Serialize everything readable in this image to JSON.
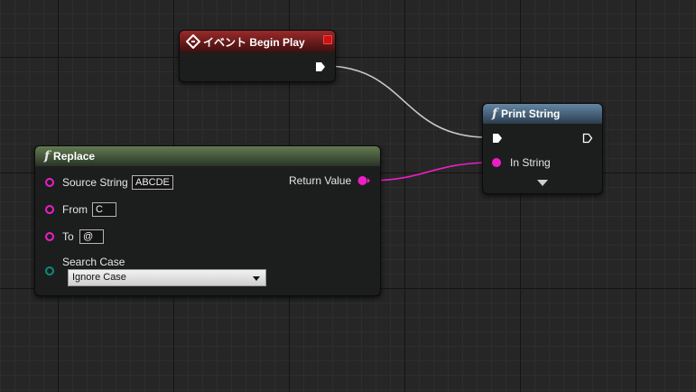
{
  "event_node": {
    "title": "イベント Begin Play"
  },
  "print_node": {
    "title": "Print String",
    "in_string_label": "In String"
  },
  "replace_node": {
    "title": "Replace",
    "source_label": "Source String",
    "source_value": "ABCDE",
    "from_label": "From",
    "from_value": "C",
    "to_label": "To",
    "to_value": "@",
    "search_case_label": "Search Case",
    "search_case_value": "Ignore Case",
    "return_label": "Return Value"
  },
  "colors": {
    "string_pin": "#ee1ec7",
    "exec_wire": "#c8c8c8",
    "event_header": "#8a2323",
    "function_header_green": "#4f6442",
    "function_header_blue": "#4e6a84",
    "enum_pin": "#0a8c7c"
  }
}
